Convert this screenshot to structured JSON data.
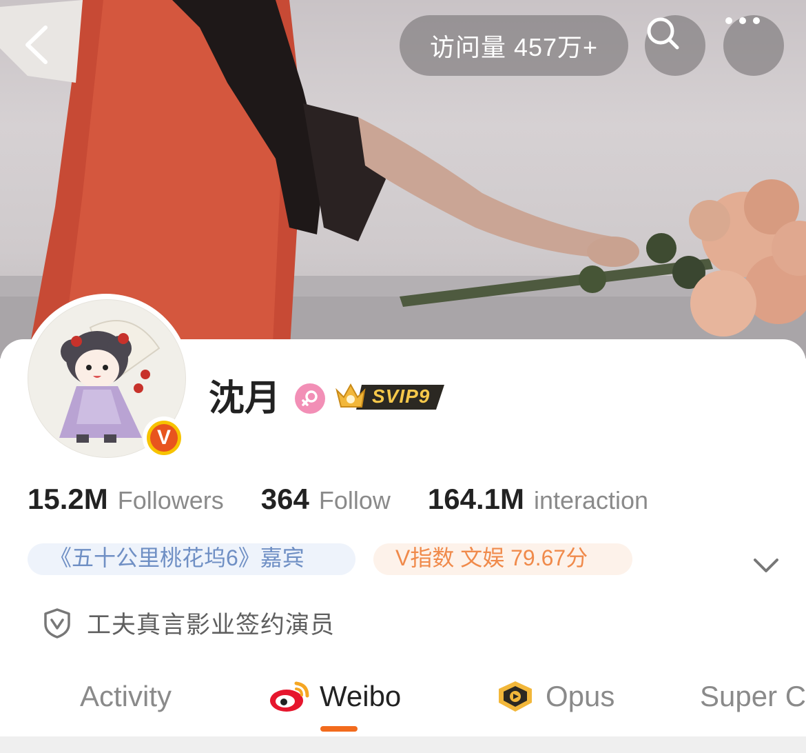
{
  "header": {
    "back_icon": "chevron-left-icon",
    "visits_label": "访问量 457万+",
    "search_icon": "search-icon",
    "more_icon": "more-dots-icon"
  },
  "profile": {
    "name": "沈月",
    "gender_icon": "female-icon",
    "vip_label": "SVIP9",
    "verified_badge": "V"
  },
  "stats": [
    {
      "value": "15.2M",
      "label": "Followers"
    },
    {
      "value": "364",
      "label": "Follow"
    },
    {
      "value": "164.1M",
      "label": "interaction"
    }
  ],
  "tags": {
    "guest": "《五十公里桃花坞6》嘉宾",
    "v_index": "V指数 文娱 79.67分"
  },
  "verification": {
    "icon": "shield-v-icon",
    "text": "工夫真言影业签约演员"
  },
  "tabs": [
    {
      "label": "Activity"
    },
    {
      "label": "Weibo",
      "active": true
    },
    {
      "label": "Opus"
    },
    {
      "label": "Super C"
    }
  ],
  "colors": {
    "accent": "#f26b1d",
    "tag_blue_text": "#6f8fc4",
    "tag_orange_text": "#f08a4b",
    "gender_pink": "#f28fb6"
  }
}
